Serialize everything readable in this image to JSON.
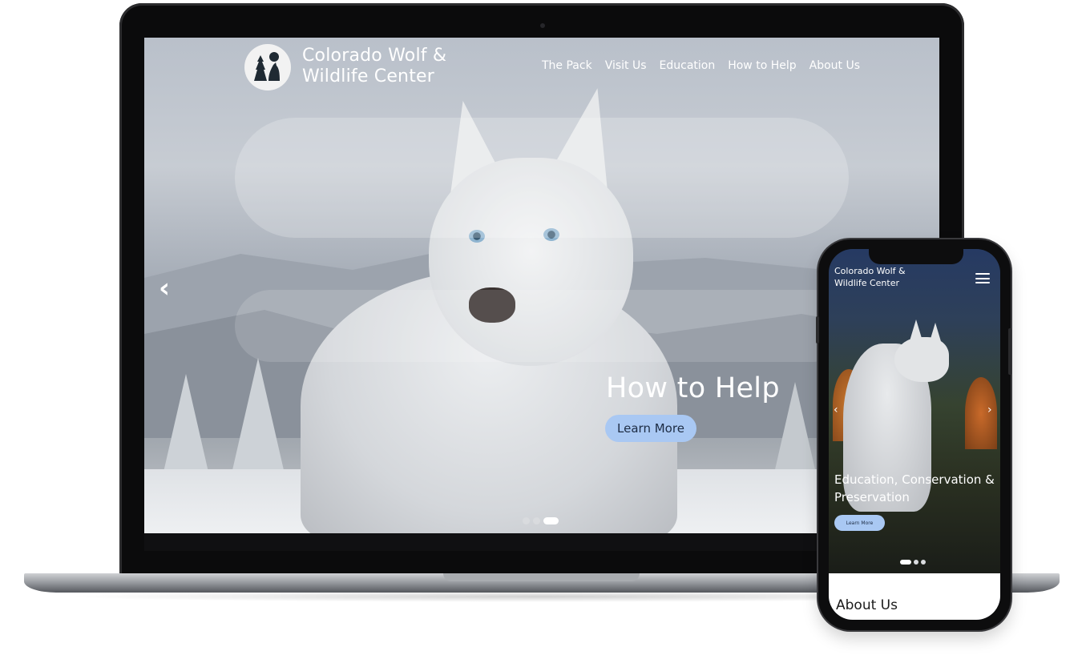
{
  "laptop": {
    "brand_line1": "Colorado Wolf &",
    "brand_line2": "Wildlife Center",
    "nav": [
      "The Pack",
      "Visit Us",
      "Education",
      "How to Help",
      "About Us"
    ],
    "prev_arrow": "‹",
    "hero_title": "How to Help",
    "cta_label": "Learn More",
    "carousel": {
      "count": 3,
      "active_index": 2
    }
  },
  "phone": {
    "brand_line1": "Colorado Wolf &",
    "brand_line2": "Wildlife Center",
    "prev_arrow": "‹",
    "next_arrow": "›",
    "hero_title": "Education, Conservation & Preservation",
    "cta_label": "Learn More",
    "carousel": {
      "count": 3,
      "active_index": 0
    },
    "section_title": "About Us"
  },
  "icons": {
    "logo": "wolf-howling-moon-logo-icon",
    "menu": "hamburger-menu-icon"
  },
  "colors": {
    "accent_button": "#a9c8f3",
    "button_text": "#1d2c44"
  }
}
